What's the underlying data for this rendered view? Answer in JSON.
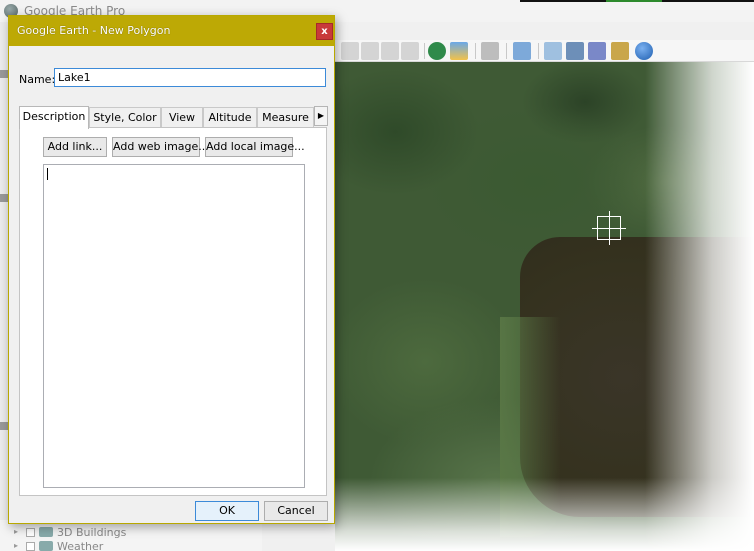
{
  "main_window": {
    "title": "Google Earth Pro",
    "layers": [
      "3D Buildings",
      "Weather"
    ]
  },
  "dialog": {
    "title": "Google Earth - New Polygon",
    "close_label": "x",
    "name_label": "Name:",
    "name_value": "Lake1",
    "tabs": [
      {
        "label": "Description",
        "active": true
      },
      {
        "label": "Style, Color",
        "active": false
      },
      {
        "label": "View",
        "active": false
      },
      {
        "label": "Altitude",
        "active": false
      },
      {
        "label": "Measure",
        "active": false
      }
    ],
    "tab_scroll_icon": "▶",
    "buttons": {
      "add_link": "Add link...",
      "add_web_image": "Add web image...",
      "add_local_image": "Add local image...",
      "ok": "OK",
      "cancel": "Cancel"
    },
    "description_value": ""
  },
  "colors": {
    "dialog_titlebar": "#bda905",
    "close_button": "#c83a3a",
    "focus_border": "#3c8ad8"
  }
}
